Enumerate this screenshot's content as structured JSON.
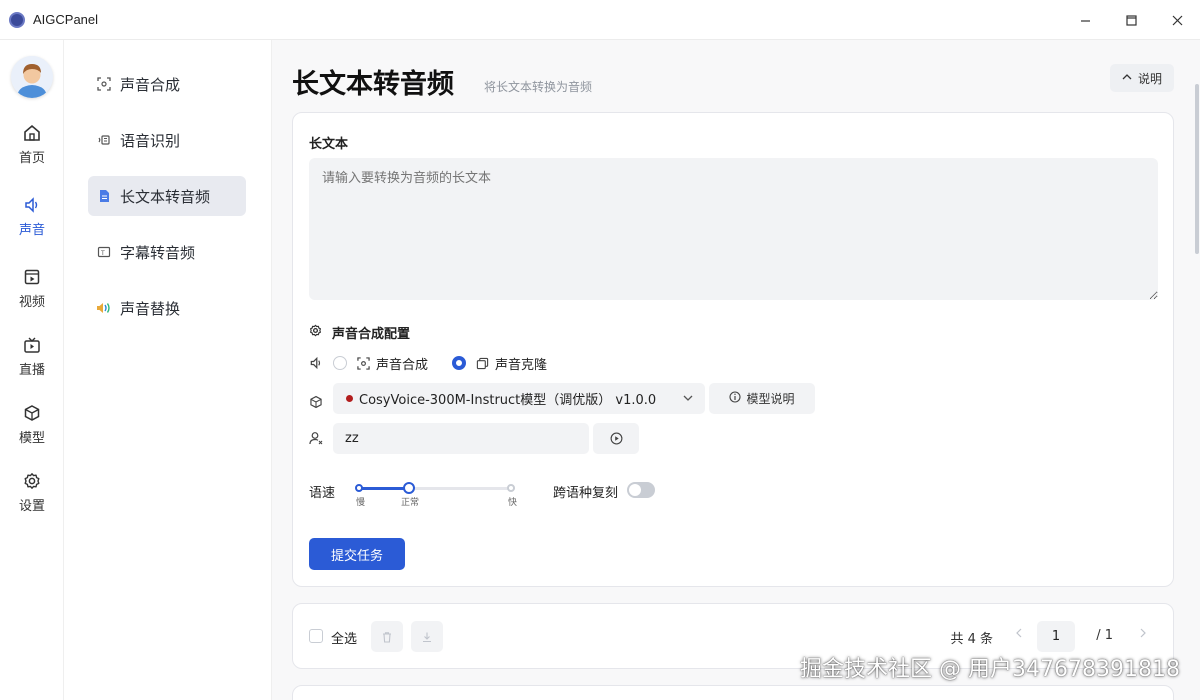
{
  "window": {
    "title": "AIGCPanel",
    "minimize": "—",
    "maximize": "☐",
    "close": "✕"
  },
  "rail": {
    "items": [
      {
        "label": "首页",
        "icon": "home-icon"
      },
      {
        "label": "声音",
        "icon": "sound-icon",
        "active": true
      },
      {
        "label": "视频",
        "icon": "video-icon"
      },
      {
        "label": "直播",
        "icon": "live-tv-icon"
      },
      {
        "label": "模型",
        "icon": "cube-icon"
      },
      {
        "label": "设置",
        "icon": "gear-icon"
      }
    ]
  },
  "subnav": {
    "items": [
      {
        "label": "声音合成",
        "icon": "scan-icon"
      },
      {
        "label": "语音识别",
        "icon": "voice-recognition-icon"
      },
      {
        "label": "长文本转音频",
        "icon": "document-icon",
        "active": true
      },
      {
        "label": "字幕转音频",
        "icon": "subtitle-icon"
      },
      {
        "label": "声音替换",
        "icon": "sound-replace-icon"
      }
    ]
  },
  "page": {
    "title": "长文本转音频",
    "subtitle": "将长文本转换为音频",
    "help_label": "说明"
  },
  "form": {
    "text_label": "长文本",
    "text_placeholder": "请输入要转换为音频的长文本",
    "config_title": "声音合成配置",
    "mode_options": [
      {
        "label": "声音合成",
        "selected": false
      },
      {
        "label": "声音克隆",
        "selected": true
      }
    ],
    "model_select": "CosyVoice-300M-Instruct模型（调优版） v1.0.0",
    "model_info_label": "模型说明",
    "voice_value": "zz",
    "speed_label": "语速",
    "speed_ticks": [
      "慢",
      "正常",
      "快"
    ],
    "speed_value_index": 1,
    "cross_lingual_label": "跨语种复刻",
    "cross_lingual_on": false,
    "submit_label": "提交任务"
  },
  "list": {
    "select_all_label": "全选",
    "total_text": "共 4 条",
    "page_current": "1",
    "page_total": "/ 1"
  },
  "watermark": "掘金技术社区 @ 用户347678391818",
  "colors": {
    "accent": "#2b5bd6",
    "field_bg": "#f2f3f5",
    "model_dot": "#b21d1d"
  }
}
